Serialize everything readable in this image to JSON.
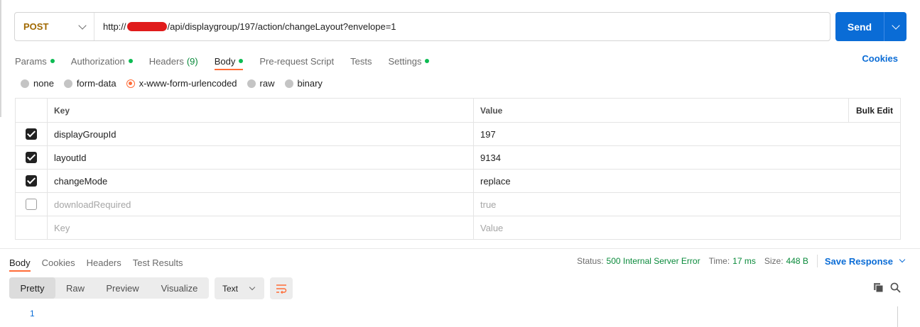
{
  "request": {
    "method": "POST",
    "url_prefix": "http://",
    "url_suffix": "/api/displaygroup/197/action/changeLayout?envelope=1",
    "send_label": "Send"
  },
  "tabs": [
    {
      "label": "Params",
      "dot": true
    },
    {
      "label": "Authorization",
      "dot": true
    },
    {
      "label": "Headers",
      "count": "(9)"
    },
    {
      "label": "Body",
      "dot": true,
      "active": true
    },
    {
      "label": "Pre-request Script"
    },
    {
      "label": "Tests"
    },
    {
      "label": "Settings",
      "dot": true
    }
  ],
  "cookies_link": "Cookies",
  "body_types": [
    "none",
    "form-data",
    "x-www-form-urlencoded",
    "raw",
    "binary"
  ],
  "body_type_selected": "x-www-form-urlencoded",
  "params_table": {
    "headers": {
      "key": "Key",
      "value": "Value",
      "bulk_edit": "Bulk Edit"
    },
    "rows": [
      {
        "checked": true,
        "key": "displayGroupId",
        "value": "197"
      },
      {
        "checked": true,
        "key": "layoutId",
        "value": "9134"
      },
      {
        "checked": true,
        "key": "changeMode",
        "value": "replace"
      },
      {
        "checked": false,
        "key": "downloadRequired",
        "value": "true"
      }
    ],
    "placeholder": {
      "key": "Key",
      "value": "Value"
    }
  },
  "response": {
    "tabs": [
      "Body",
      "Cookies",
      "Headers",
      "Test Results"
    ],
    "status_label": "Status:",
    "status_value": "500 Internal Server Error",
    "time_label": "Time:",
    "time_value": "17 ms",
    "size_label": "Size:",
    "size_value": "448 B",
    "save_response": "Save Response",
    "view_modes": [
      "Pretty",
      "Raw",
      "Preview",
      "Visualize"
    ],
    "format": "Text",
    "line_number": "1"
  },
  "colors": {
    "accent": "#ff6c37",
    "primary": "#0a6cd6",
    "success": "#0cbb52",
    "method_post": "#a16900",
    "redaction": "#e01b1b"
  }
}
